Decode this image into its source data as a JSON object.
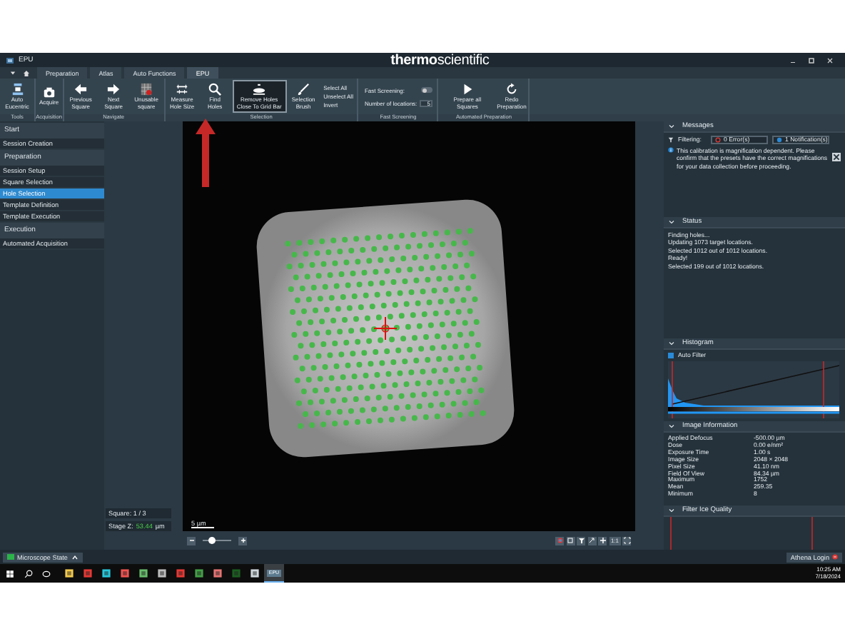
{
  "window": {
    "app_title": "EPU",
    "brand": "**thermo**scientific"
  },
  "tabs": [
    {
      "label": "Preparation",
      "selected": false
    },
    {
      "label": "Atlas",
      "selected": false
    },
    {
      "label": "Auto Functions",
      "selected": false
    },
    {
      "label": "EPU",
      "selected": true
    }
  ],
  "ribbon": {
    "groups": [
      {
        "label": "Tools",
        "items": [
          {
            "kind": "large",
            "label": "Auto Eucentric",
            "active": false
          }
        ]
      },
      {
        "label": "Acquisition",
        "items": [
          {
            "kind": "large",
            "label": "Acquire",
            "active": false
          }
        ]
      },
      {
        "label": "Navigate",
        "items": [
          {
            "kind": "large",
            "label": "Previous Square",
            "active": false
          },
          {
            "kind": "large",
            "label": "Next Square",
            "active": false
          },
          {
            "kind": "large",
            "label": "Unusable square",
            "active": false
          }
        ]
      },
      {
        "label": "Selection",
        "items": [
          {
            "kind": "large",
            "label": "Measure Hole Size",
            "active": false
          },
          {
            "kind": "large",
            "label": "Find Holes",
            "active": false
          },
          {
            "kind": "large",
            "label": "Remove Holes Close To Grid Bar",
            "active": true
          },
          {
            "kind": "large",
            "label": "Selection Brush",
            "active": false
          },
          {
            "kind": "small",
            "label": "Select All"
          },
          {
            "kind": "small",
            "label": "Unselect All"
          },
          {
            "kind": "small",
            "label": "Invert"
          }
        ]
      },
      {
        "label": "Fast Screening",
        "items": [
          {
            "kind": "toggle",
            "label": "Fast Screening:",
            "on": false
          },
          {
            "kind": "number",
            "label": "Number of locations:",
            "value": "5"
          }
        ]
      },
      {
        "label": "Automated Preparation",
        "items": [
          {
            "kind": "large",
            "label": "Prepare all Squares",
            "active": false
          },
          {
            "kind": "large",
            "label": "Redo Preparation",
            "active": false
          }
        ]
      }
    ]
  },
  "sidebar": {
    "sections": [
      {
        "title": "Start",
        "items": [
          {
            "label": "Session Creation",
            "selected": false
          }
        ]
      },
      {
        "title": "Preparation",
        "items": [
          {
            "label": "Session Setup",
            "selected": false
          },
          {
            "label": "Square Selection",
            "selected": false
          },
          {
            "label": "Hole Selection",
            "selected": true
          },
          {
            "label": "Template Definition",
            "selected": false
          },
          {
            "label": "Template Execution",
            "selected": false
          }
        ]
      },
      {
        "title": "Execution",
        "items": [
          {
            "label": "Automated Acquisition",
            "selected": false
          }
        ]
      }
    ]
  },
  "position": {
    "square": "Square: 1 / 3",
    "stage_z_label": "Stage Z:",
    "stage_z_value": "53.44",
    "stage_z_unit": "µm"
  },
  "viewer": {
    "scale_bar": "5 µm",
    "zoom": {
      "level": 0.3
    },
    "one_to_one": "1:1"
  },
  "messages": {
    "title": "Messages",
    "filtering": "Filtering:",
    "errors": "0 Error(s)",
    "notifications": "1 Notification(s)",
    "text": "This calibration is magnification dependent. Please confirm that the presets have the correct magnifications for your data collection before proceeding."
  },
  "status": {
    "title": "Status",
    "lines": [
      "Finding holes...",
      "Updating 1073 target locations.",
      "Selected 1012 out of 1012 locations.",
      "Ready!",
      "Selected 199 out of 1012 locations."
    ]
  },
  "histogram": {
    "title": "Histogram",
    "auto_filter": {
      "label": "Auto Filter",
      "checked": true
    }
  },
  "image_information": {
    "title": "Image Information",
    "rows": [
      {
        "key": "Applied Defocus",
        "value": "-500.00 µm"
      },
      {
        "key": "Dose",
        "value": "0.00 e/nm²"
      },
      {
        "key": "Exposure Time",
        "value": "1.00 s"
      },
      {
        "key": "Image Size",
        "value": "2048 × 2048"
      },
      {
        "key": "Pixel Size",
        "value": "41.10 nm"
      },
      {
        "key": "Field Of View",
        "value": "84.34 µm"
      },
      {
        "key": "Maximum",
        "value": "1752"
      },
      {
        "key": "Mean",
        "value": "259.35"
      },
      {
        "key": "Minimum",
        "value": "8"
      }
    ]
  },
  "filter_ice_quality": {
    "title": "Filter Ice Quality"
  },
  "status_bar": {
    "microscope_state": "Microscope State",
    "athena_login": "Athena Login"
  },
  "taskbar": {
    "apps": [
      {
        "active": false
      },
      {
        "active": false
      },
      {
        "active": false
      },
      {
        "active": false
      },
      {
        "active": false
      },
      {
        "active": false
      },
      {
        "active": false
      },
      {
        "active": false
      },
      {
        "active": false
      },
      {
        "active": false
      },
      {
        "active": false
      },
      {
        "active": true,
        "label": "EPU"
      }
    ],
    "time": "10:25 AM",
    "date": "7/18/2024"
  }
}
